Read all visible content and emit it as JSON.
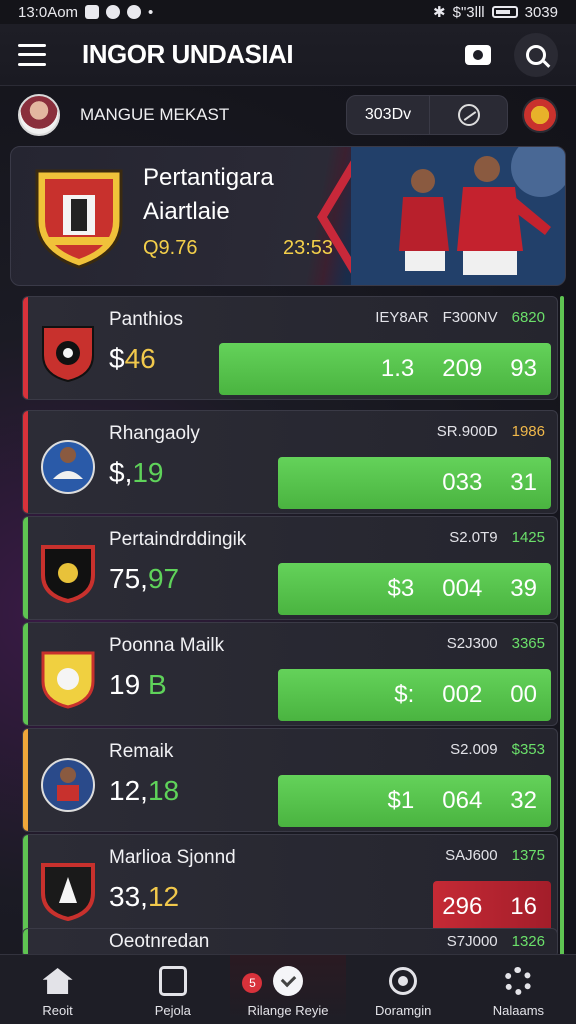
{
  "status": {
    "time": "13:0Aom",
    "right": "$\"3lll",
    "battery": "3039"
  },
  "appbar": {
    "title": "INGOR UNDASIAI"
  },
  "profile": {
    "name": "MANGUE MEKAST",
    "select": "303Dv"
  },
  "hero": {
    "title_line1": "Pertantigara",
    "title_line2": "Aiartlaie",
    "score": "Q9.76",
    "time": "23:53"
  },
  "rows": [
    {
      "name": "Panthios",
      "price_a": "$",
      "price_b": "46",
      "meta": [
        "IEY8AR",
        "F300NV",
        "6820"
      ],
      "bar": [
        "1.3",
        "209",
        "93"
      ],
      "accent": "#d8323b",
      "bar_width": 0.62,
      "bar_red": false
    },
    {
      "name": "Rhangaoly",
      "price_a": "$,",
      "price_b": "19",
      "meta": [
        "SR.900D",
        "1986"
      ],
      "bar": [
        "033",
        "31"
      ],
      "accent": "#d8323b",
      "bar_width": 0.51,
      "bar_red": false
    },
    {
      "name": "Pertaindrddingik",
      "price_a": "75,",
      "price_b": "97",
      "meta": [
        "S2.0T9",
        "1425"
      ],
      "bar": [
        "$3",
        "004",
        "39"
      ],
      "accent": "#5fc452",
      "bar_width": 0.51,
      "bar_red": false
    },
    {
      "name": "Poonna Mailk",
      "price_a": "19",
      "price_b": "B",
      "meta": [
        "S2J300",
        "3365"
      ],
      "bar": [
        "$:",
        "002",
        "00"
      ],
      "accent": "#5fc452",
      "bar_width": 0.51,
      "bar_red": false
    },
    {
      "name": "Remaik",
      "price_a": "12,",
      "price_b": "18",
      "meta": [
        "S2.009",
        "$353"
      ],
      "bar": [
        "$1",
        "064",
        "32"
      ],
      "accent": "#f0a63a",
      "bar_width": 0.51,
      "bar_red": false
    },
    {
      "name": "Marlioa Sjonnd",
      "price_a": "33,",
      "price_b": "12",
      "meta": [
        "SAJ600",
        "1375"
      ],
      "bar": [
        "296",
        "16"
      ],
      "accent": "#5fc452",
      "bar_width": 0.22,
      "bar_red": true
    },
    {
      "name": "Oeotnredan",
      "price_a": "",
      "price_b": "",
      "meta": [
        "S7J000",
        "1326"
      ],
      "bar": [],
      "accent": "#5fc452",
      "bar_width": 0,
      "bar_red": false
    }
  ],
  "nav": [
    {
      "label": "Reoit",
      "icon": "home-icon"
    },
    {
      "label": "Pejola",
      "icon": "doc-icon"
    },
    {
      "label": "Rilange Reyie",
      "icon": "check-icon",
      "badge": "5"
    },
    {
      "label": "Doramgin",
      "icon": "target-icon"
    },
    {
      "label": "Nalaams",
      "icon": "gear-icon"
    }
  ]
}
